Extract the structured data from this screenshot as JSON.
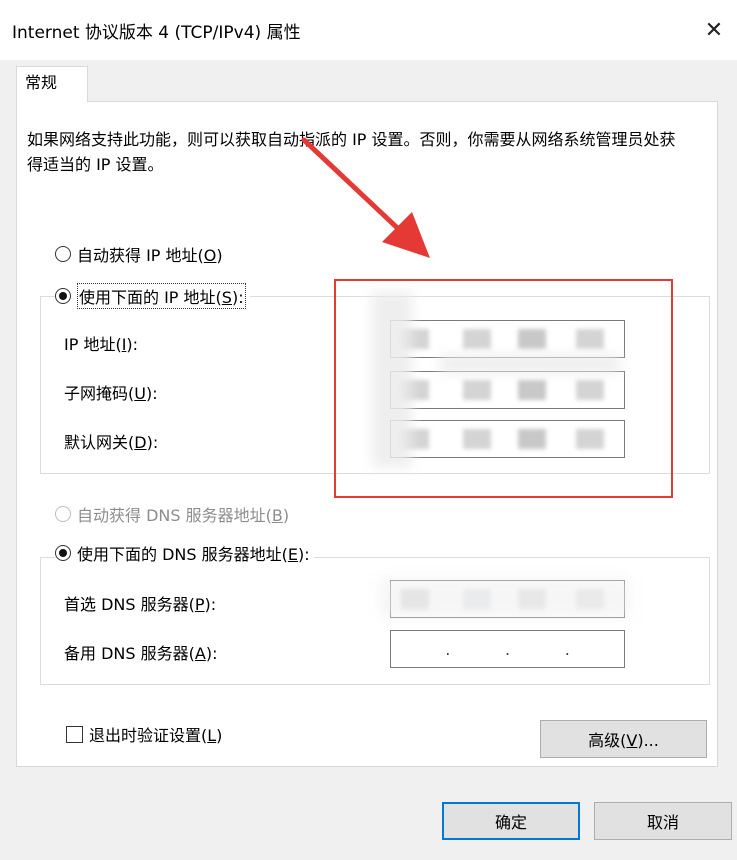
{
  "window": {
    "title": "Internet 协议版本 4 (TCP/IPv4) 属性",
    "close_glyph": "✕"
  },
  "tab": {
    "label": "常规"
  },
  "description": "如果网络支持此功能，则可以获取自动指派的 IP 设置。否则，你需要从网络系统管理员处获得适当的 IP 设置。",
  "ip_mode": {
    "auto": {
      "label": "自动获得 IP 地址(",
      "key": "O",
      "suffix": ")",
      "checked": false
    },
    "manual": {
      "label": "使用下面的 IP 地址(",
      "key": "S",
      "suffix": "):",
      "checked": true
    }
  },
  "ip_fields": {
    "ip": {
      "label": "IP 地址(",
      "key": "I",
      "suffix": "):"
    },
    "mask": {
      "label": "子网掩码(",
      "key": "U",
      "suffix": "):"
    },
    "gateway": {
      "label": "默认网关(",
      "key": "D",
      "suffix": "):"
    }
  },
  "dns_mode": {
    "auto": {
      "label": "自动获得 DNS 服务器地址(",
      "key": "B",
      "suffix": ")",
      "checked": false,
      "enabled": false
    },
    "manual": {
      "label": "使用下面的 DNS 服务器地址(",
      "key": "E",
      "suffix": "):",
      "checked": true
    }
  },
  "dns_fields": {
    "preferred": {
      "label": "首选 DNS 服务器(",
      "key": "P",
      "suffix": "):"
    },
    "alternate": {
      "label": "备用 DNS 服务器(",
      "key": "A",
      "suffix": "):",
      "dots": "."
    }
  },
  "validate": {
    "label": "退出时验证设置(",
    "key": "L",
    "suffix": ")",
    "checked": false
  },
  "buttons": {
    "advanced": {
      "label": "高级(",
      "key": "V",
      "suffix": ")..."
    },
    "ok": "确定",
    "cancel": "取消"
  },
  "annotation": {
    "color": "#e53935"
  }
}
